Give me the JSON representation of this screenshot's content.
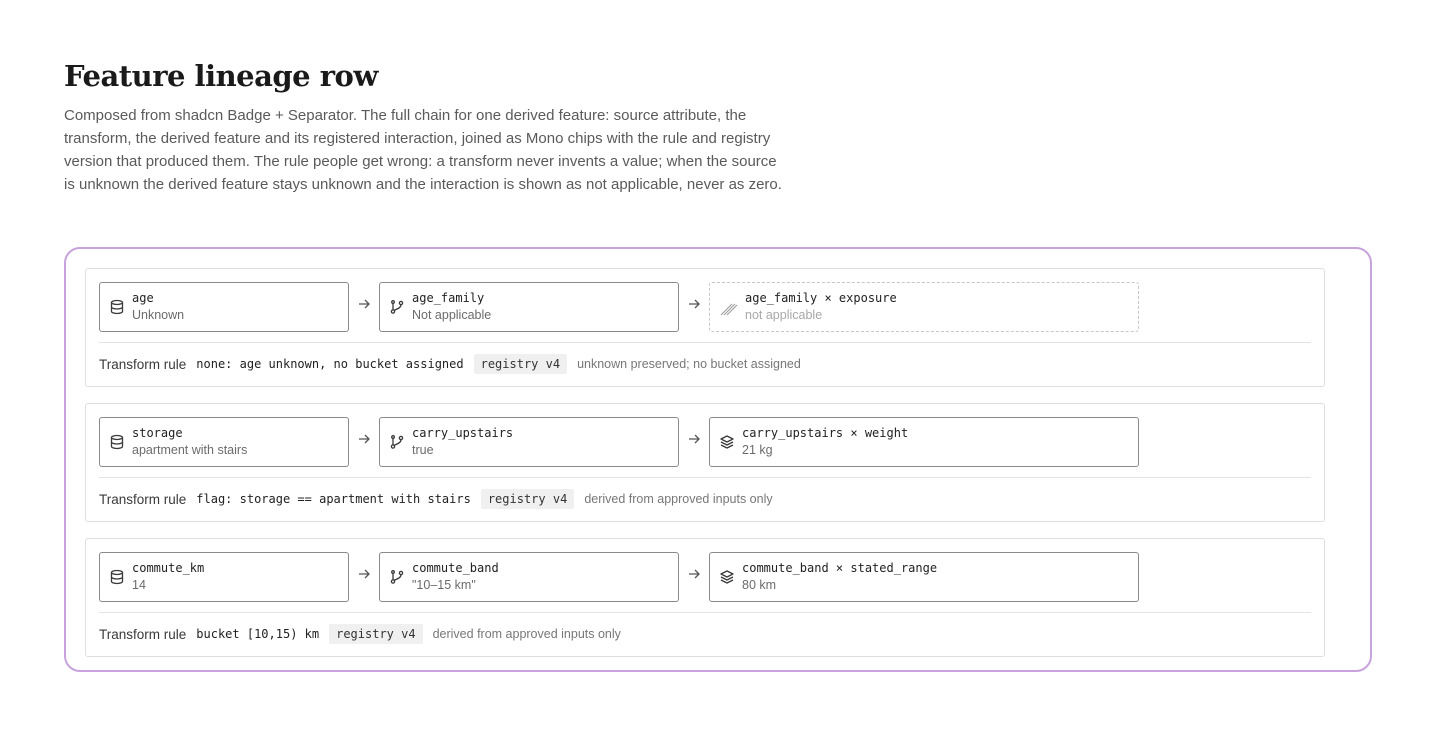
{
  "page": {
    "title": "Feature lineage row",
    "description": "Composed from shadcn Badge + Separator. The full chain for one derived feature: source attribute, the transform, the derived feature and its registered interaction, joined as Mono chips with the rule and registry version that produced them. The rule people get wrong: a transform never invents a value; when the source is unknown the derived feature stays unknown and the interaction is shown as not applicable, never as zero."
  },
  "colors": {
    "frame_border": "#c8a2dc",
    "chip_border": "#8a8a8a",
    "muted_text": "#6b6b6b",
    "na_text": "#a8a8a8",
    "badge_bg": "#f0f0f0"
  },
  "rows": [
    {
      "source": {
        "icon": "database-icon",
        "name": "age",
        "value": "Unknown"
      },
      "derived": {
        "icon": "git-branch-icon",
        "name": "age_family",
        "value": "Not applicable"
      },
      "interaction": {
        "icon": "hatch-icon",
        "name": "age_family × exposure",
        "value": "not applicable",
        "not_applicable": true
      },
      "rule": {
        "label": "Transform rule",
        "code": "none: age unknown, no bucket assigned",
        "registry": "registry v4",
        "note": "unknown preserved; no bucket assigned"
      }
    },
    {
      "source": {
        "icon": "database-icon",
        "name": "storage",
        "value": "apartment with stairs"
      },
      "derived": {
        "icon": "git-branch-icon",
        "name": "carry_upstairs",
        "value": "true"
      },
      "interaction": {
        "icon": "layers-icon",
        "name": "carry_upstairs × weight",
        "value": "21 kg",
        "not_applicable": false
      },
      "rule": {
        "label": "Transform rule",
        "code": "flag: storage == apartment with stairs",
        "registry": "registry v4",
        "note": "derived from approved inputs only"
      }
    },
    {
      "source": {
        "icon": "database-icon",
        "name": "commute_km",
        "value": "14"
      },
      "derived": {
        "icon": "git-branch-icon",
        "name": "commute_band",
        "value": "\"10–15 km\""
      },
      "interaction": {
        "icon": "layers-icon",
        "name": "commute_band × stated_range",
        "value": "80 km",
        "not_applicable": false
      },
      "rule": {
        "label": "Transform rule",
        "code": "bucket [10,15) km",
        "registry": "registry v4",
        "note": "derived from approved inputs only"
      }
    }
  ]
}
